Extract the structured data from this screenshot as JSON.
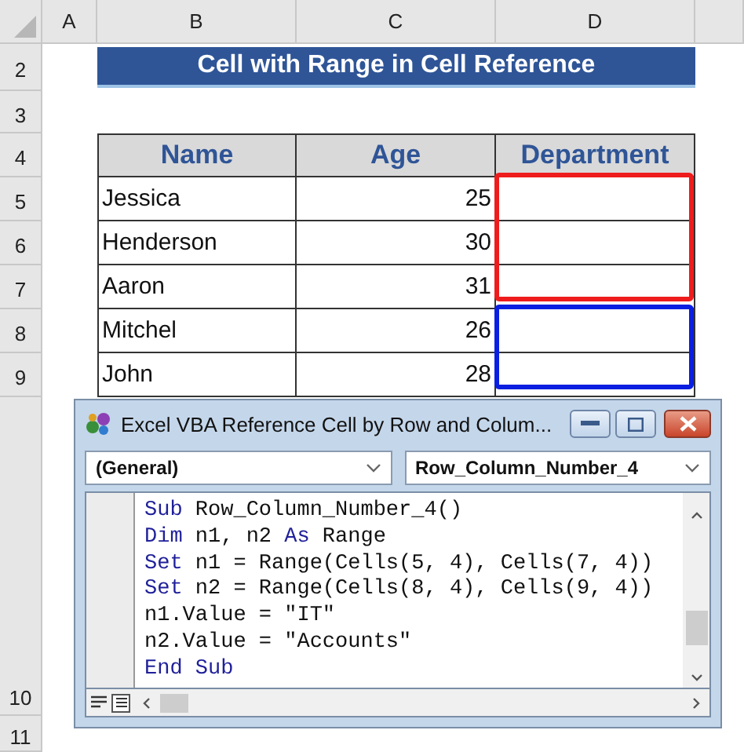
{
  "sheet": {
    "columns": [
      "A",
      "B",
      "C",
      "D"
    ],
    "title_row": {
      "row": "2",
      "text": "Cell with Range in Cell Reference"
    },
    "blank_row": "3",
    "header_row": {
      "row": "4",
      "cells": [
        "Name",
        "Age",
        "Department"
      ]
    },
    "rows": [
      {
        "row": "5",
        "name": "Jessica",
        "age": "25",
        "color": "#ee1c1c"
      },
      {
        "row": "6",
        "name": "Henderson",
        "age": "30",
        "color": "#ee1c1c"
      },
      {
        "row": "7",
        "name": "Aaron",
        "age": "31",
        "color": "#ee1c1c"
      },
      {
        "row": "8",
        "name": "Mitchel",
        "age": "26",
        "color": "#0a1fe0"
      },
      {
        "row": "9",
        "name": "John",
        "age": "28",
        "color": "#0a1fe0"
      }
    ],
    "lower_rows": [
      "10",
      "11"
    ]
  },
  "vba_window": {
    "title": "Excel VBA Reference Cell by Row and Colum...",
    "object_combo": "(General)",
    "procedure_combo": "Row_Column_Number_4",
    "code": [
      [
        {
          "kind": "keyword",
          "text": "Sub"
        },
        {
          "kind": "plain",
          "text": " Row_Column_Number_4()"
        }
      ],
      [
        {
          "kind": "keyword",
          "text": "Dim"
        },
        {
          "kind": "plain",
          "text": " n1, n2 "
        },
        {
          "kind": "keyword",
          "text": "As"
        },
        {
          "kind": "plain",
          "text": " Range"
        }
      ],
      [
        {
          "kind": "keyword",
          "text": "Set"
        },
        {
          "kind": "plain",
          "text": " n1 = Range(Cells(5, 4), Cells(7, 4))"
        }
      ],
      [
        {
          "kind": "keyword",
          "text": "Set"
        },
        {
          "kind": "plain",
          "text": " n2 = Range(Cells(8, 4), Cells(9, 4))"
        }
      ],
      [
        {
          "kind": "plain",
          "text": "n1.Value = \"IT\""
        }
      ],
      [
        {
          "kind": "plain",
          "text": "n2.Value = \"Accounts\""
        }
      ],
      [
        {
          "kind": "keyword",
          "text": "End Sub"
        }
      ]
    ]
  }
}
